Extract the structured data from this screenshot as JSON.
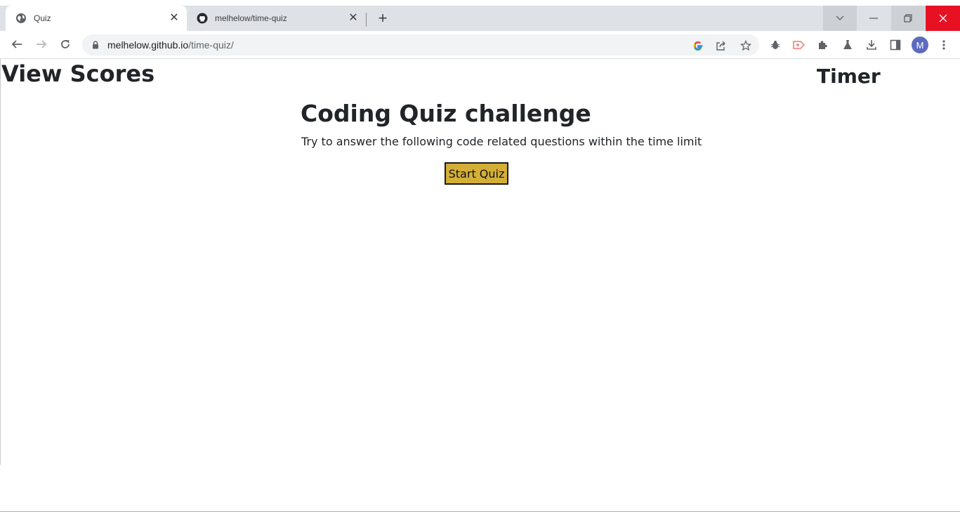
{
  "browser": {
    "tabs": [
      {
        "title": "Quiz",
        "icon": "globe-icon",
        "active": true
      },
      {
        "title": "melhelow/time-quiz",
        "icon": "github-icon",
        "active": false
      }
    ],
    "address": {
      "domain": "melhelow.github.io",
      "path": "/time-quiz/"
    },
    "profile_initial": "M",
    "colors": {
      "tabstrip": "#dee1e6",
      "close_window": "#e81123",
      "avatar": "#5c6bc0"
    }
  },
  "page": {
    "view_scores": "View Scores",
    "timer": "Timer",
    "title": "Coding Quiz challenge",
    "description": "Try to answer the following code related questions within the time limit",
    "start_button": "Start Quiz",
    "colors": {
      "start_button_bg": "#d4af37",
      "text": "#212529"
    }
  }
}
